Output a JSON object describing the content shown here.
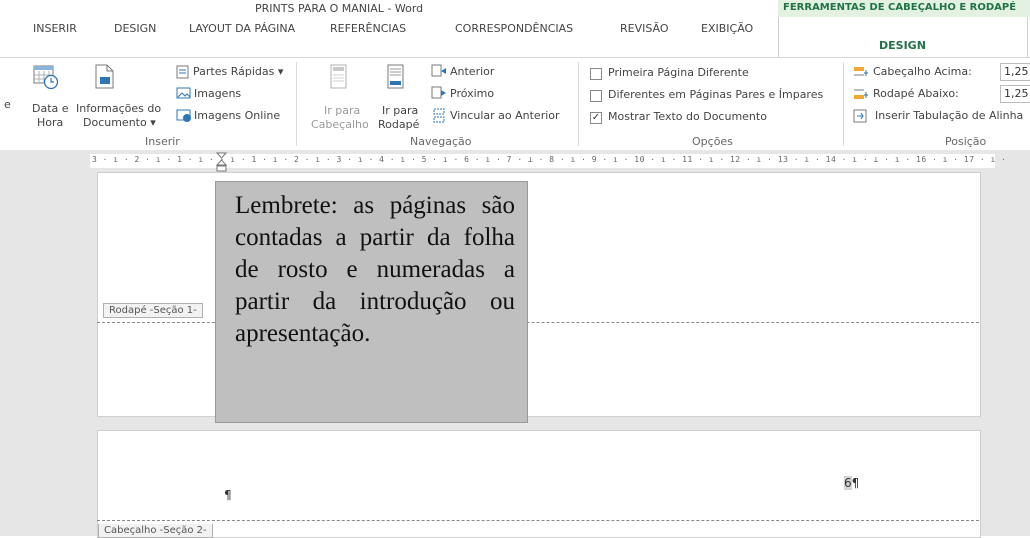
{
  "window": {
    "title": "PRINTS PARA O MANIAL - Word",
    "context_tools": "FERRAMENTAS DE CABEÇALHO E RODAPÉ"
  },
  "tabs": [
    "INSERIR",
    "DESIGN",
    "LAYOUT DA PÁGINA",
    "REFERÊNCIAS",
    "CORRESPONDÊNCIAS",
    "REVISÃO",
    "EXIBIÇÃO"
  ],
  "context_tab": "DESIGN",
  "ribbon": {
    "cut_label": "e",
    "inserir": {
      "data_hora_1": "Data e",
      "data_hora_2": "Hora",
      "info_doc_1": "Informações do",
      "info_doc_2": "Documento ▾",
      "partes_rapidas": "Partes Rápidas ▾",
      "imagens": "Imagens",
      "imagens_online": "Imagens Online",
      "group": "Inserir"
    },
    "navegacao": {
      "ir_cabecalho_1": "Ir para",
      "ir_cabecalho_2": "Cabeçalho",
      "ir_rodape_1": "Ir para",
      "ir_rodape_2": "Rodapé",
      "anterior": "Anterior",
      "proximo": "Próximo",
      "vincular": "Vincular ao Anterior",
      "group": "Navegação"
    },
    "opcoes": {
      "primeira_pagina": "Primeira Página Diferente",
      "pares_impares": "Diferentes em Páginas Pares e Ímpares",
      "mostrar_texto": "Mostrar Texto do Documento",
      "check_mark": "✓",
      "group": "Opções"
    },
    "posicao": {
      "cabecalho_acima": "Cabeçalho Acima:",
      "cabecalho_val": "1,25",
      "rodape_abaixo": "Rodapé Abaixo:",
      "rodape_val": "1,25",
      "inserir_tab": "Inserir Tabulação de Alinha",
      "group": "Posição"
    }
  },
  "ruler": "3 · ı · 2 · ı · 1 · ı ·   · ı · 1 · ı · 2 · ı · 3 · ı · 4 · ı · 5 · ı · 6 · ı · 7 · ⊥ · 8 · ı · 9 · ı · 10 · ı · 11 · ı · 12 · ı · 13 · ı · 14 · ı · ⊥ · ı · 16 · ı · 17 · ı ·",
  "document": {
    "footer_label": "Rodapé -Seção 1-",
    "header_label": "Cabeçalho -Seção 2-",
    "callout": "Lembrete: as páginas são contadas a partir da folha de rosto e numeradas a partir da introdução ou apresentação.",
    "pilcrow": "¶",
    "page_number": "6",
    "page_number_mark": "¶"
  }
}
